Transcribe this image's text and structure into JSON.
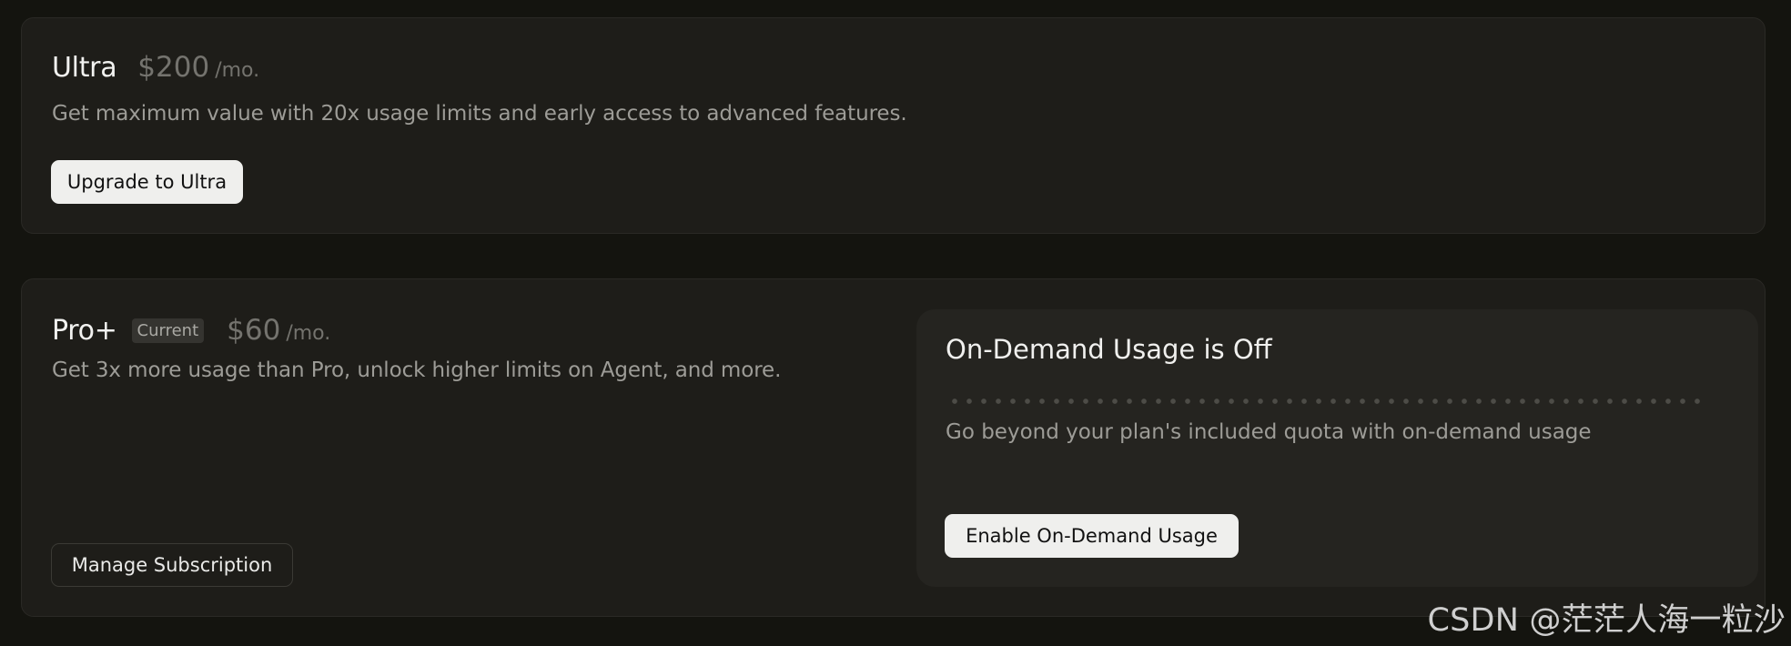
{
  "plans": {
    "ultra": {
      "name": "Ultra",
      "price": "$200",
      "period": "/mo.",
      "description": "Get maximum value with 20x usage limits and early access to advanced features.",
      "button_label": "Upgrade to Ultra"
    },
    "pro_plus": {
      "name": "Pro+",
      "badge": "Current",
      "price": "$60",
      "period": "/mo.",
      "description": "Get 3x more usage than Pro, unlock higher limits on Agent, and more.",
      "button_label": "Manage Subscription"
    }
  },
  "on_demand": {
    "title": "On-Demand Usage is Off",
    "description": "Go beyond your plan's included quota with on-demand usage",
    "button_label": "Enable On-Demand Usage"
  },
  "watermark": "CSDN @茫茫人海一粒沙",
  "colors": {
    "page_background": "#14140f",
    "card_background": "#1e1d19",
    "panel_background": "#252420",
    "primary_button": "#efefed",
    "muted_text": "#9d9c97"
  }
}
